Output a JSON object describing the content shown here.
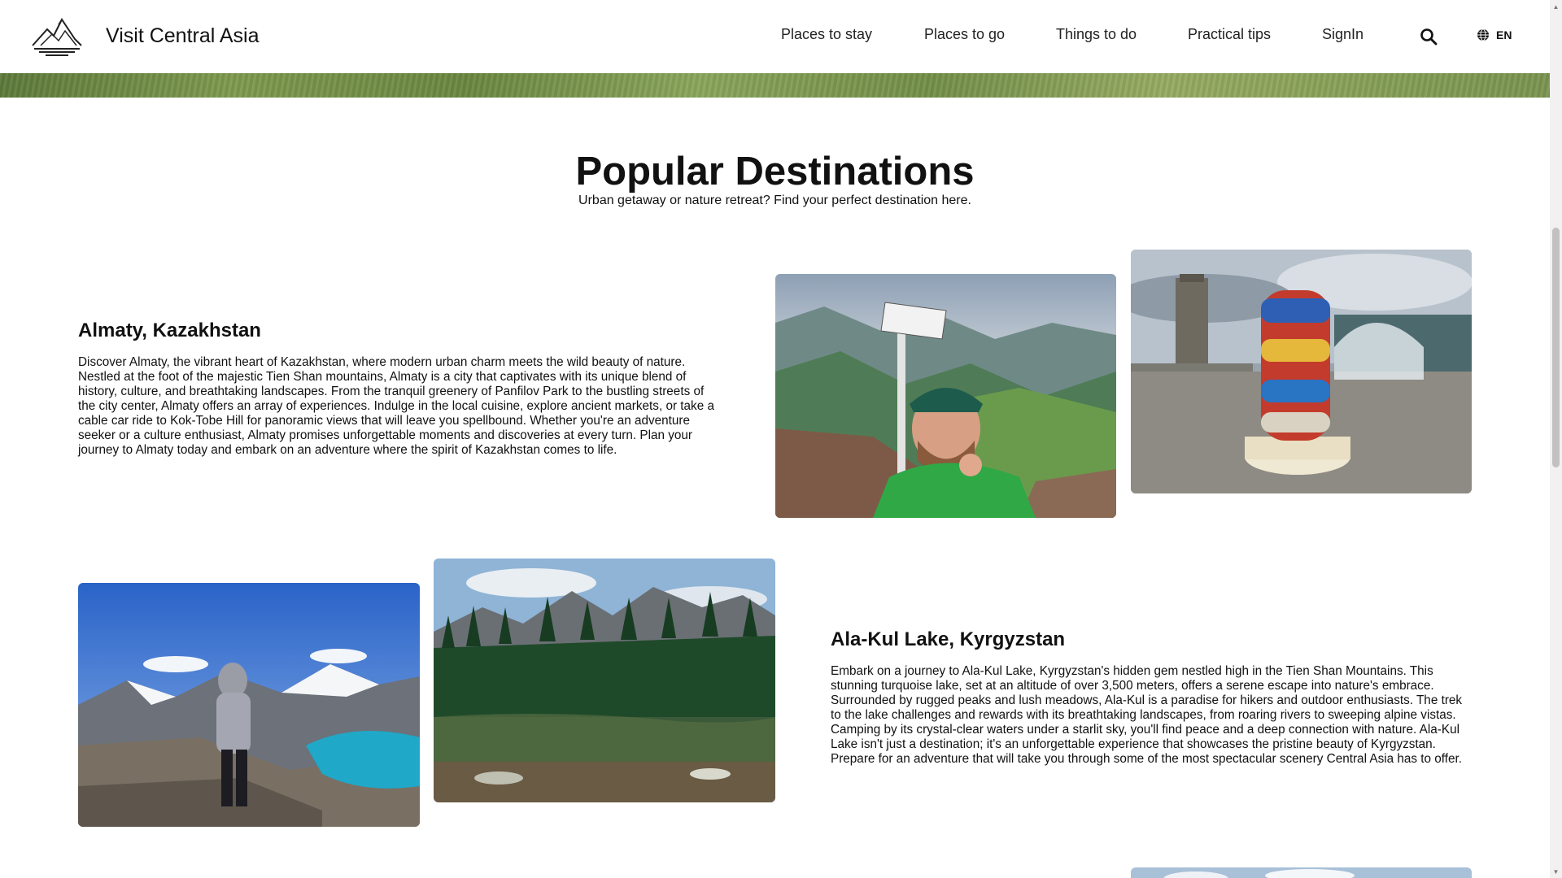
{
  "header": {
    "brand": "Visit Central Asia",
    "nav": [
      "Places to stay",
      "Places to go",
      "Things to do",
      "Practical tips",
      "SignIn"
    ],
    "language": "EN"
  },
  "section": {
    "title": "Popular Destinations",
    "subtitle": "Urban getaway or nature retreat? Find your perfect destination here."
  },
  "destinations": [
    {
      "title": "Almaty, Kazakhstan",
      "description": "Discover Almaty, the vibrant heart of Kazakhstan, where modern urban charm meets the wild beauty of nature. Nestled at the foot of the majestic Tien Shan mountains, Almaty is a city that captivates with its unique blend of history, culture, and breathtaking landscapes. From the tranquil greenery of Panfilov Park to the bustling streets of the city center, Almaty offers an array of experiences. Indulge in the local cuisine, explore ancient markets, or take a cable car ride to Kok-Tobe Hill for panoramic views that will leave you spellbound. Whether you're an adventure seeker or a culture enthusiast, Almaty promises unforgettable moments and discoveries at every turn. Plan your journey to Almaty today and embark on an adventure where the spirit of Kazakhstan comes to life."
    },
    {
      "title": "Ala-Kul Lake, Kyrgyzstan",
      "description": "Embark on a journey to Ala-Kul Lake, Kyrgyzstan's hidden gem nestled high in the Tien Shan Mountains. This stunning turquoise lake, set at an altitude of over 3,500 meters, offers a serene escape into nature's embrace. Surrounded by rugged peaks and lush meadows, Ala-Kul is a paradise for hikers and outdoor enthusiasts. The trek to the lake challenges and rewards with its breathtaking landscapes, from roaring rivers to sweeping alpine vistas. Camping by its crystal-clear waters under a starlit sky, you'll find peace and a deep connection with nature. Ala-Kul Lake isn't just a destination; it's an unforgettable experience that showcases the pristine beauty of Kyrgyzstan. Prepare for an adventure that will take you through some of the most spectacular scenery Central Asia has to offer."
    }
  ],
  "icons": {
    "logo": "mountain-logo-icon",
    "search": "search-icon",
    "language": "globe-icon"
  }
}
